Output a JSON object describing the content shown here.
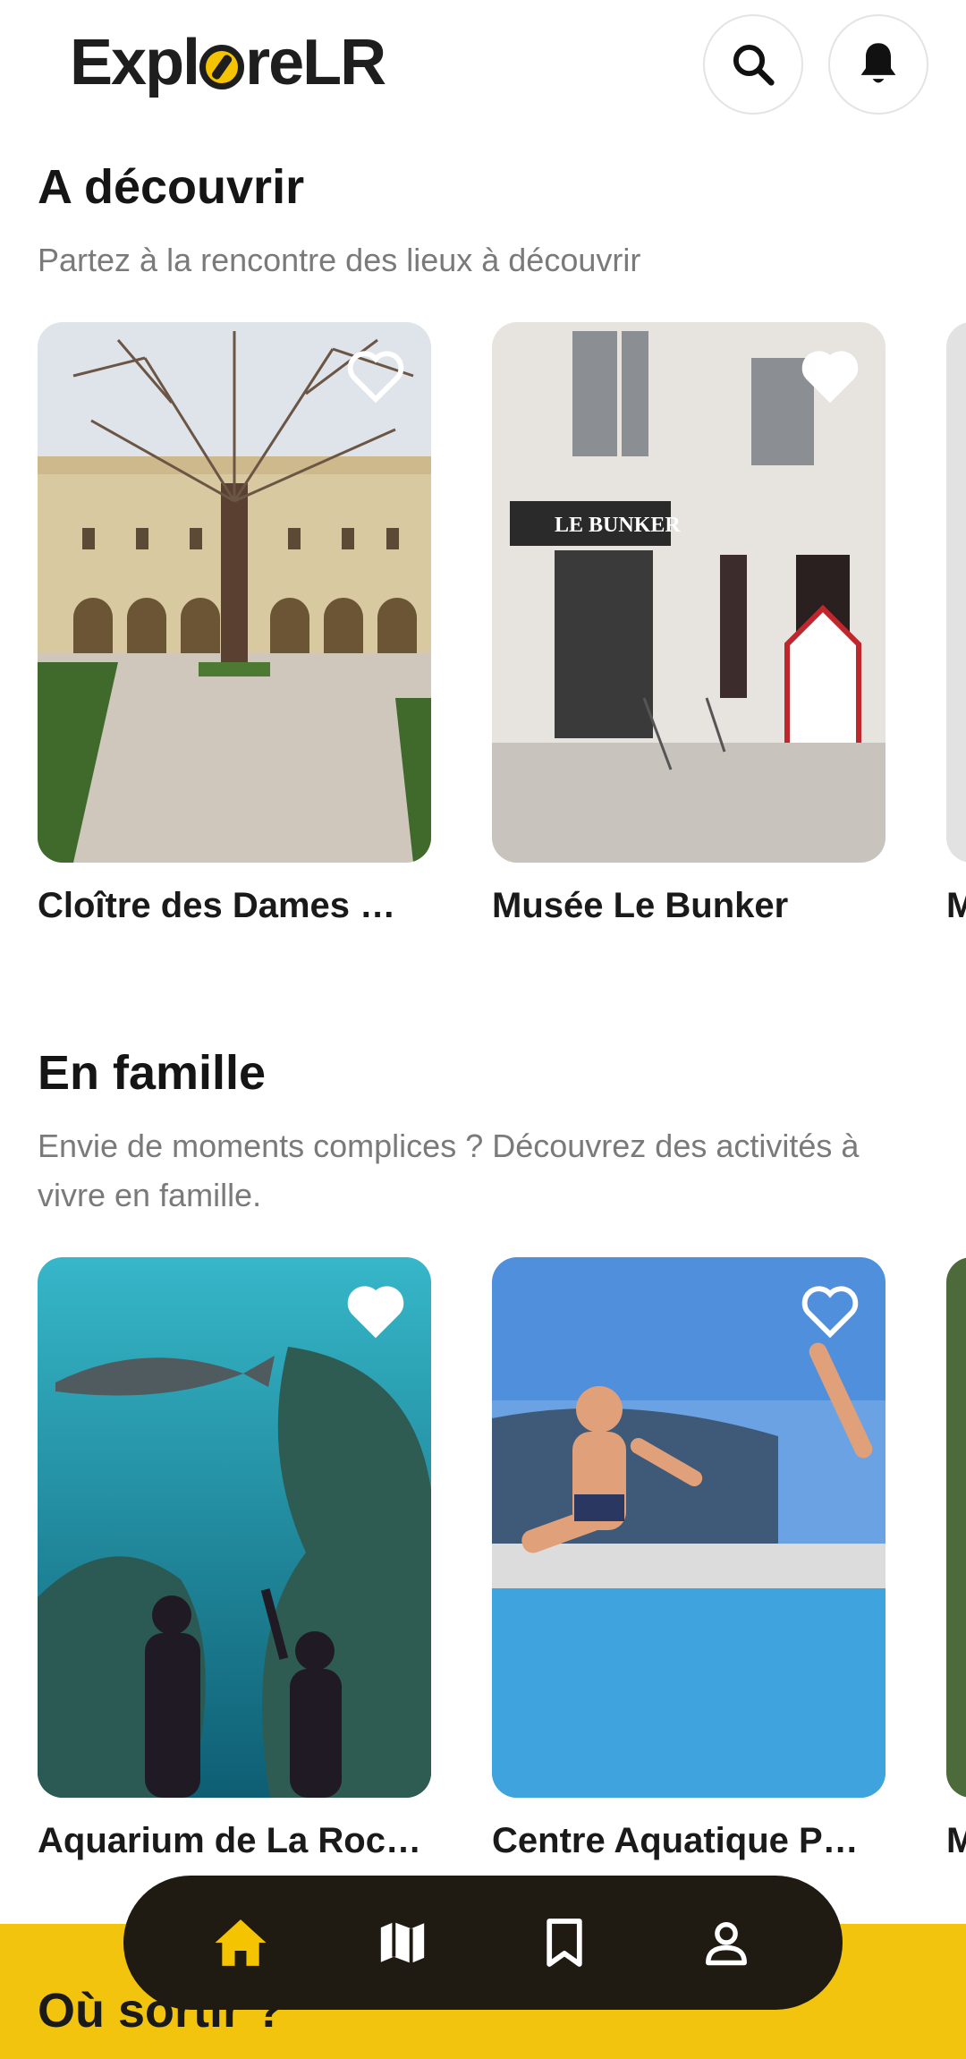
{
  "app": {
    "logo_text_left": "Expl",
    "logo_text_right": "reLR",
    "logo_icon": "compass-o-icon",
    "accent_color": "#f5c400"
  },
  "header": {
    "search_icon": "search-icon",
    "notification_icon": "bell-icon"
  },
  "sections": [
    {
      "title": "A découvrir",
      "subtitle": "Partez à la rencontre des lieux à découvrir",
      "cards": [
        {
          "title": "Cloître des Dames …",
          "favorite": false,
          "image": "cloister-courtyard-photo"
        },
        {
          "title": "Musée Le Bunker",
          "favorite": true,
          "image": "museum-bunker-storefront-photo"
        }
      ],
      "peek_title": "M"
    },
    {
      "title": "En famille",
      "subtitle": "Envie de moments complices ? Découvrez des activités à vivre en famille.",
      "cards": [
        {
          "title": "Aquarium de La Roc…",
          "favorite": true,
          "image": "aquarium-shark-tank-photo"
        },
        {
          "title": "Centre Aquatique P…",
          "favorite": false,
          "image": "outdoor-pool-jump-photo"
        }
      ],
      "peek_title": "M"
    },
    {
      "title": "Où sortir ?"
    }
  ],
  "bottom_nav": {
    "items": [
      {
        "icon": "home-icon",
        "active": true
      },
      {
        "icon": "map-icon",
        "active": false
      },
      {
        "icon": "bookmark-icon",
        "active": false
      },
      {
        "icon": "profile-icon",
        "active": false
      }
    ],
    "active_color": "#f5c400",
    "inactive_color": "#ffffff"
  }
}
